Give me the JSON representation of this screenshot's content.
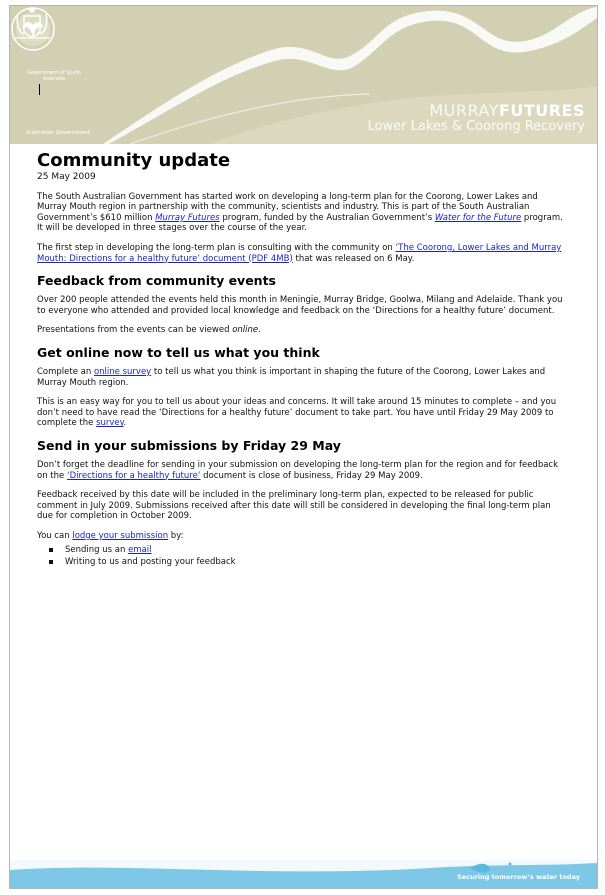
{
  "header": {
    "sa_logo_text": "Government of South Australia",
    "aus_logo_text": "Australian Government",
    "brand_thin": "MURRAY",
    "brand_bold": "FUTURES",
    "brand_sub": "Lower Lakes & Coorong Recovery"
  },
  "doc": {
    "title": "Community update",
    "date": "25 May 2009",
    "intro": {
      "p1_a": "The South Australian Government has started work on developing a long-term plan for the Coorong, Lower Lakes and Murray Mouth region in partnership with the community, scientists and industry.  This is part of the South Australian Government’s $610 million ",
      "p1_link1": "Murray Futures",
      "p1_b": " program, funded by the Australian Government’s ",
      "p1_link2": "Water for the Future",
      "p1_c": " program.  It will be developed in three stages over the course of the year.",
      "p2_a": "The first step in developing the long-term plan is consulting with the community on ",
      "p2_link": "‘The Coorong, Lower Lakes and Murray Mouth: Directions for a healthy future’ document (PDF 4MB)",
      "p2_b": " that was released on 6 May."
    },
    "s1": {
      "heading": "Feedback from community events",
      "p1": "Over 200 people attended the events held this month in Meningie, Murray Bridge, Goolwa, Milang and Adelaide. Thank you to everyone who attended and provided local knowledge and feedback on the ‘Directions for a healthy future’ document.",
      "p2_a": "Presentations from the events can be viewed ",
      "p2_em": "online",
      "p2_b": "."
    },
    "s2": {
      "heading": "Get online now to tell us what you think",
      "p1_a": "Complete an ",
      "p1_link": "online survey",
      "p1_b": " to tell us what you think is important in shaping the future of the Coorong, Lower Lakes and Murray Mouth region.",
      "p2_a": "This is an easy way for you to tell us about your ideas and concerns.  It will take around 15 minutes to complete – and you don’t need to have read the ‘Directions for a healthy future’ document to take part.  You have until Friday 29 May 2009 to complete the ",
      "p2_link": "survey",
      "p2_b": "."
    },
    "s3": {
      "heading": "Send in your submissions by Friday 29 May",
      "p1_a": "Don’t forget the deadline for sending in your submission on developing the long-term plan for the region and for feedback on the ",
      "p1_link": "‘Directions for a healthy future’",
      "p1_b": " document is close of business, Friday 29 May 2009.",
      "p2": "Feedback received by this date will be included in the preliminary long-term plan, expected to be released for public comment in July 2009. Submissions received after this date will still be considered in developing the final long-term plan due for completion in October 2009.",
      "p3_a": "You can ",
      "p3_link": "lodge your submission",
      "p3_b": " by:",
      "bullet1_a": "Sending us an ",
      "bullet1_link": "email",
      "bullet2": "Writing to us and posting your feedback"
    }
  },
  "footer": {
    "tagline": "Securing tomorrow’s water today"
  },
  "colors": {
    "banner": "#d2d0b2",
    "footer": "#7dc7e7",
    "link": "#1b24c4"
  }
}
